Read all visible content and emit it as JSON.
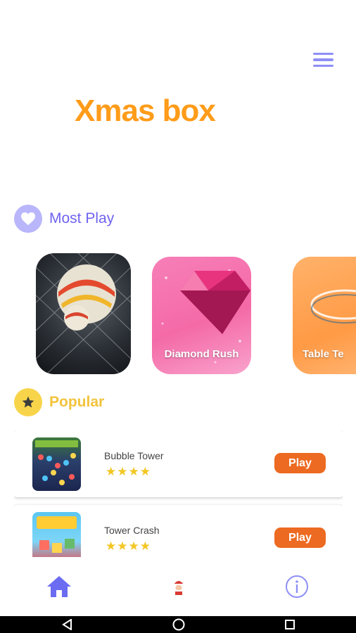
{
  "header": {
    "title": "Xmas box",
    "menu_icon": "hamburger-menu-icon"
  },
  "most_play": {
    "label": "Most Play",
    "icon": "heart-icon",
    "cards": [
      {
        "title": "",
        "image": "soccer-ball-net"
      },
      {
        "title": "Diamond Rush",
        "image": "pink-diamond"
      },
      {
        "title": "Table Te",
        "image": "table-tennis"
      }
    ]
  },
  "popular": {
    "label": "Popular",
    "icon": "star-icon",
    "games": [
      {
        "name": "Bubble Tower",
        "rating": "★★★★",
        "play_label": "Play"
      },
      {
        "name": "Tower Crash",
        "rating": "★★★★",
        "play_label": "Play"
      }
    ]
  },
  "bottom_nav": {
    "items": [
      "home-icon",
      "santa-icon",
      "info-icon"
    ]
  },
  "system_nav": {
    "items": [
      "back-icon",
      "home-circle-icon",
      "recents-icon"
    ]
  },
  "colors": {
    "title": "#ff9c1a",
    "accent_purple": "#6f63f0",
    "popular_yellow": "#f2c33c",
    "play_button": "#ec6a21",
    "stars": "#f3c623"
  }
}
